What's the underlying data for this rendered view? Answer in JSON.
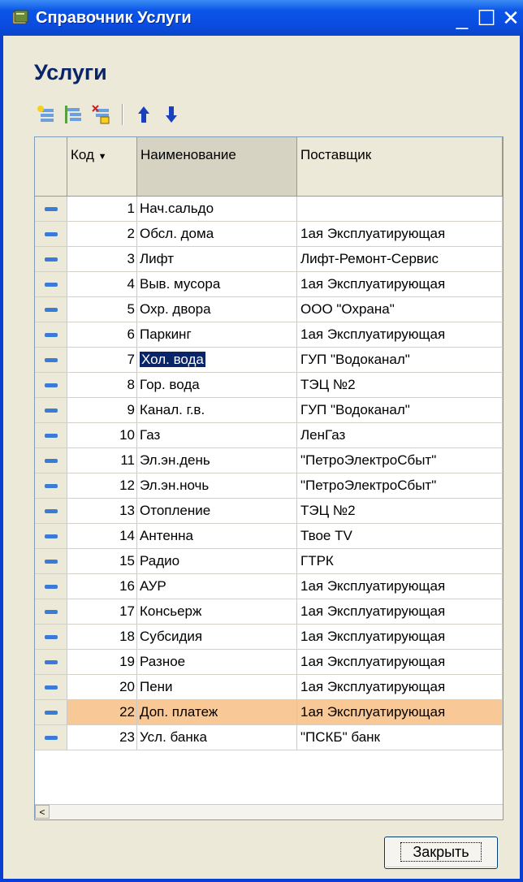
{
  "window": {
    "title": "Справочник Услуги",
    "minimize": "_",
    "maximize": "☐",
    "close": "✕"
  },
  "heading": "Услуги",
  "toolbar": {
    "icons": [
      "add-icon",
      "add-group-icon",
      "delete-mark-icon",
      "move-up-icon",
      "move-down-icon"
    ]
  },
  "grid": {
    "columns": [
      "Код",
      "Наименование",
      "Поставщик"
    ],
    "rows": [
      {
        "code": "1",
        "name": "Нач.сальдо",
        "supplier": ""
      },
      {
        "code": "2",
        "name": "Обсл. дома",
        "supplier": "1ая Эксплуатирующая"
      },
      {
        "code": "3",
        "name": "Лифт",
        "supplier": "Лифт-Ремонт-Сервис"
      },
      {
        "code": "4",
        "name": "Выв. мусора",
        "supplier": "1ая Эксплуатирующая"
      },
      {
        "code": "5",
        "name": "Охр. двора",
        "supplier": "ООО \"Охрана\""
      },
      {
        "code": "6",
        "name": "Паркинг",
        "supplier": "1ая Эксплуатирующая"
      },
      {
        "code": "7",
        "name": "Хол. вода",
        "supplier": "ГУП \"Водоканал\""
      },
      {
        "code": "8",
        "name": "Гор. вода",
        "supplier": "ТЭЦ №2"
      },
      {
        "code": "9",
        "name": "Канал. г.в.",
        "supplier": "ГУП \"Водоканал\""
      },
      {
        "code": "10",
        "name": "Газ",
        "supplier": "ЛенГаз"
      },
      {
        "code": "11",
        "name": "Эл.эн.день",
        "supplier": "\"ПетроЭлектроСбыт\""
      },
      {
        "code": "12",
        "name": "Эл.эн.ночь",
        "supplier": "\"ПетроЭлектроСбыт\""
      },
      {
        "code": "13",
        "name": "Отопление",
        "supplier": "ТЭЦ №2"
      },
      {
        "code": "14",
        "name": "Антенна",
        "supplier": "Твое TV"
      },
      {
        "code": "15",
        "name": "Радио",
        "supplier": "ГТРК"
      },
      {
        "code": "16",
        "name": "АУР",
        "supplier": "1ая Эксплуатирующая"
      },
      {
        "code": "17",
        "name": "Консьерж",
        "supplier": "1ая Эксплуатирующая"
      },
      {
        "code": "18",
        "name": "Субсидия",
        "supplier": "1ая Эксплуатирующая"
      },
      {
        "code": "19",
        "name": "Разное",
        "supplier": "1ая Эксплуатирующая"
      },
      {
        "code": "20",
        "name": "Пени",
        "supplier": "1ая Эксплуатирующая"
      },
      {
        "code": "22",
        "name": "Доп. платеж",
        "supplier": "1ая Эксплуатирующая"
      },
      {
        "code": "23",
        "name": "Усл. банка",
        "supplier": "\"ПСКБ\" банк"
      }
    ]
  },
  "close_button": "Закрыть"
}
